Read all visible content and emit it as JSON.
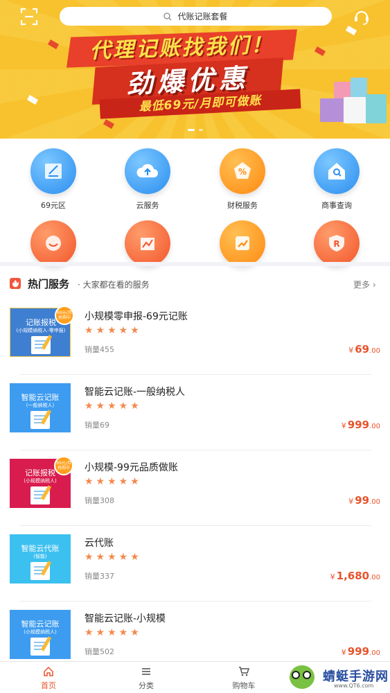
{
  "header": {
    "search_text": "代账记账套餐",
    "scan_icon": "scan-icon",
    "service_icon": "headset-icon"
  },
  "banner": {
    "line1": "代理记账找我们！",
    "line2": "劲爆优惠",
    "line3": "最低69元/月即可做账",
    "slides": 2,
    "active_slide": 1
  },
  "categories": [
    {
      "label": "69元区",
      "icon": "signature-doc-icon"
    },
    {
      "label": "云服务",
      "icon": "cloud-upload-icon"
    },
    {
      "label": "财税服务",
      "icon": "percent-tag-icon"
    },
    {
      "label": "商事查询",
      "icon": "house-search-icon"
    },
    {
      "label": "",
      "icon": "smile-leaf-icon"
    },
    {
      "label": "",
      "icon": "building-chart-icon"
    },
    {
      "label": "",
      "icon": "trend-chart-icon"
    },
    {
      "label": "",
      "icon": "shield-r-icon"
    }
  ],
  "hot_section": {
    "title": "热门服务",
    "subtitle": "大家都在看的服务",
    "more": "更多"
  },
  "products": [
    {
      "name": "小规模零申报-69元记账",
      "stars": "★★★★★",
      "sales": "销量455",
      "price_int": "69",
      "price_dec": ".00",
      "thumb_title": "记账报税",
      "thumb_sub": "(小规模纳税人-零申报)",
      "badge": "69元/月 抢购中",
      "thumb_color": "#3f7fd1"
    },
    {
      "name": "智能云记账-一般纳税人",
      "stars": "★★★★★",
      "sales": "销量69",
      "price_int": "999",
      "price_dec": ".00",
      "thumb_title": "智能云记账",
      "thumb_sub": "(一般纳税人)",
      "badge": "",
      "thumb_color": "#3d9cf0"
    },
    {
      "name": "小规模-99元品质做账",
      "stars": "★★★★★",
      "sales": "销量308",
      "price_int": "99",
      "price_dec": ".00",
      "thumb_title": "记账报税",
      "thumb_sub": "(小规模纳税人)",
      "badge": "99元/月 抢购中",
      "thumb_color": "#d91c4e"
    },
    {
      "name": "云代账",
      "stars": "★★★★★",
      "sales": "销量337",
      "price_int": "1,680",
      "price_dec": ".00",
      "thumb_title": "智能云代账",
      "thumb_sub": "(智能)",
      "badge": "",
      "thumb_color": "#3cc0f0"
    },
    {
      "name": "智能云记账-小规模",
      "stars": "★★★★★",
      "sales": "销量502",
      "price_int": "999",
      "price_dec": ".00",
      "thumb_title": "智能云记账",
      "thumb_sub": "(小规模纳税人)",
      "badge": "",
      "thumb_color": "#3d9cf0"
    }
  ],
  "currency": "¥",
  "tabbar": [
    {
      "label": "首页",
      "icon": "home-icon",
      "active": true
    },
    {
      "label": "分类",
      "icon": "list-icon",
      "active": false
    },
    {
      "label": "购物车",
      "icon": "cart-icon",
      "active": false
    }
  ],
  "watermark": {
    "name": "蜻蜓手游网",
    "url": "www.QT6.com"
  },
  "colors": {
    "accent": "#e8532c",
    "banner_bg": "#f8c533",
    "star": "#f3894d"
  }
}
